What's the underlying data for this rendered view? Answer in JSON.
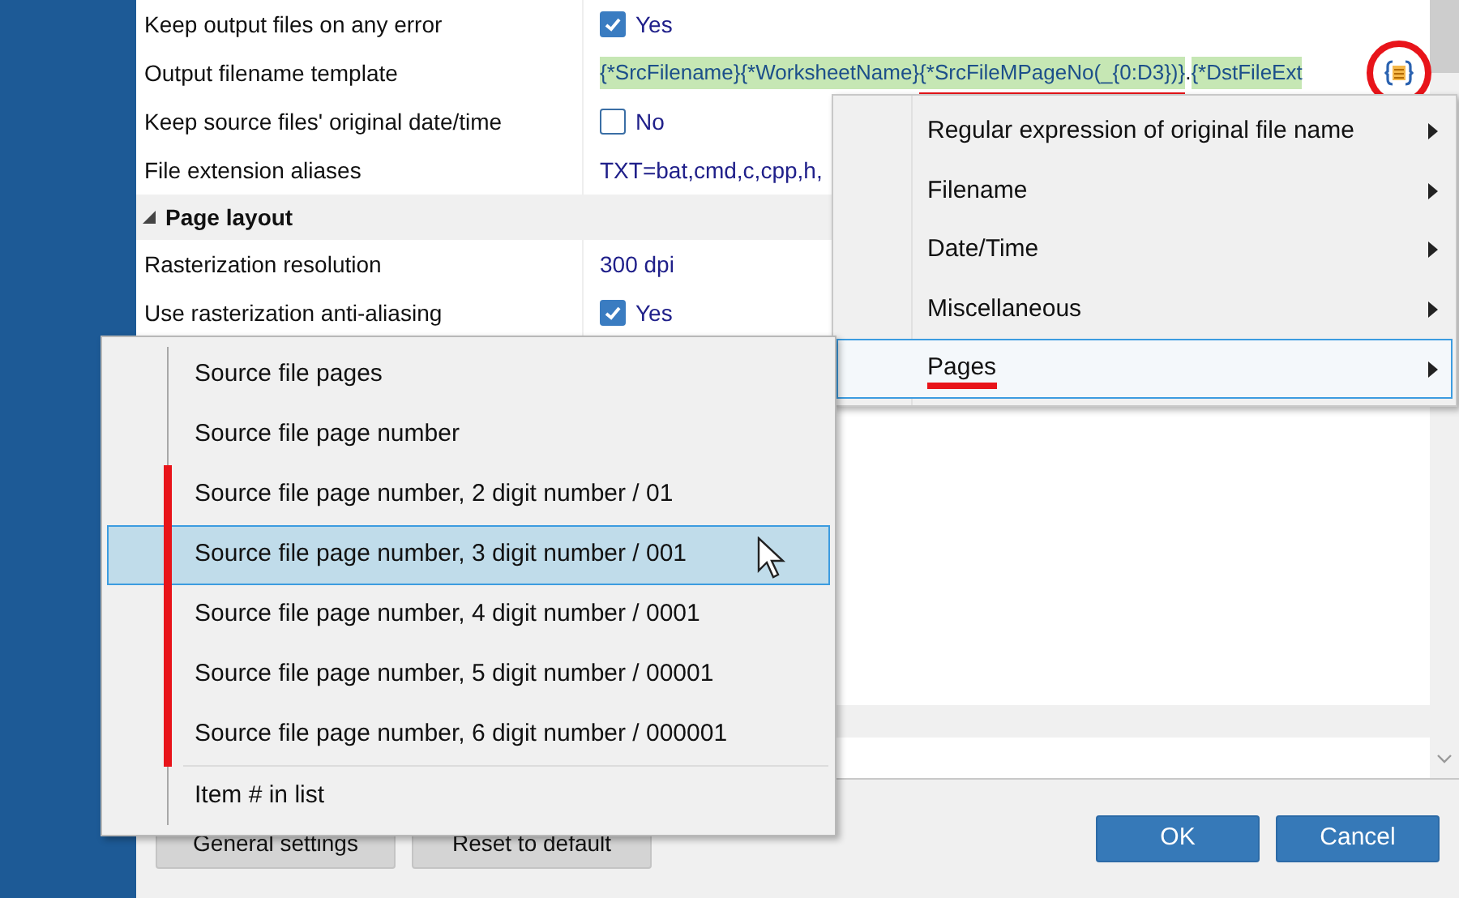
{
  "settings": [
    {
      "kind": "checkbox",
      "label": "Keep output files on any error",
      "checked": true,
      "value": "Yes"
    },
    {
      "kind": "template",
      "label": "Output filename template",
      "annotated": true,
      "segments": [
        {
          "text": "{*SrcFilename}",
          "highlighted": true,
          "annotated": false
        },
        {
          "text": "{*WorksheetName}",
          "highlighted": true,
          "annotated": false
        },
        {
          "text": "{*SrcFileMPageNo(_{0:D3})}",
          "highlighted": true,
          "annotated": true
        },
        {
          "separator": ".",
          "text": "{*DstFileExt",
          "highlighted": true,
          "annotated": false
        }
      ]
    },
    {
      "kind": "checkbox",
      "label": "Keep source files' original date/time",
      "checked": false,
      "value": "No"
    },
    {
      "kind": "text",
      "label": "File extension aliases",
      "value": "TXT=bat,cmd,c,cpp,h,"
    },
    {
      "kind": "group",
      "label": "Page layout",
      "expanded": true
    },
    {
      "kind": "text",
      "label": "Rasterization resolution",
      "value": "300 dpi"
    },
    {
      "kind": "checkbox",
      "label": "Use rasterization anti-aliasing",
      "checked": true,
      "value": "Yes"
    }
  ],
  "category_menu": [
    {
      "label": "Regular expression of original file name",
      "selected": false,
      "annotated": false
    },
    {
      "label": "Filename",
      "selected": false,
      "annotated": false
    },
    {
      "label": "Date/Time",
      "selected": false,
      "annotated": false
    },
    {
      "label": "Miscellaneous",
      "selected": false,
      "annotated": false
    },
    {
      "label": "Pages",
      "selected": true,
      "annotated": true
    }
  ],
  "pages_menu": [
    {
      "kind": "item",
      "label": "Source file pages",
      "selected": false,
      "annotated": false
    },
    {
      "kind": "item",
      "label": "Source file page number",
      "selected": false,
      "annotated": false
    },
    {
      "kind": "item",
      "label": "Source file page number, 2 digit number / 01",
      "selected": false,
      "annotated": true
    },
    {
      "kind": "item",
      "label": "Source file page number, 3 digit number / 001",
      "selected": true,
      "annotated": true
    },
    {
      "kind": "item",
      "label": "Source file page number, 4 digit number / 0001",
      "selected": false,
      "annotated": true
    },
    {
      "kind": "item",
      "label": "Source file page number, 5 digit number / 00001",
      "selected": false,
      "annotated": true
    },
    {
      "kind": "item",
      "label": "Source file page number, 6 digit number / 000001",
      "selected": false,
      "annotated": true
    },
    {
      "kind": "separator"
    },
    {
      "kind": "item",
      "label": "Item # in list",
      "selected": false,
      "annotated": false
    }
  ],
  "footer_left_buttons": [
    "General settings",
    "Reset to default"
  ],
  "buttons": [
    "OK",
    "Cancel"
  ]
}
